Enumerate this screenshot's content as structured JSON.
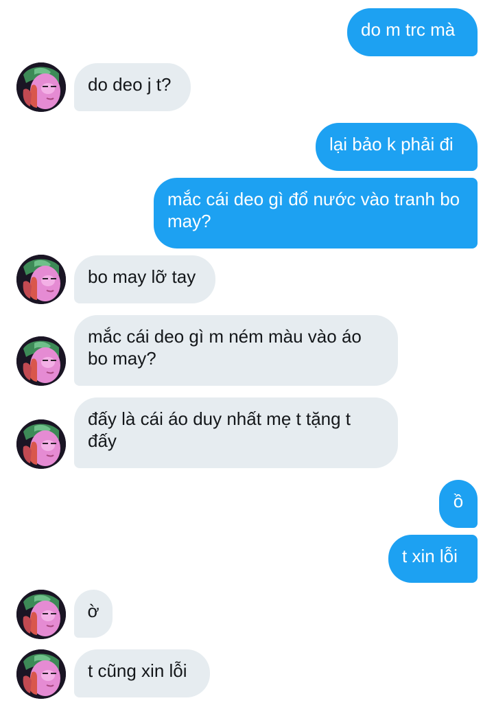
{
  "conversation": {
    "messages": [
      {
        "direction": "sent",
        "text": "do m trc mà"
      },
      {
        "direction": "received",
        "text": "do deo j t?"
      },
      {
        "direction": "sent",
        "text": "lại bảo k phải đi"
      },
      {
        "direction": "sent",
        "text": "mắc cái deo gì đổ nước vào tranh bo may?"
      },
      {
        "direction": "received",
        "text": "bo may lỡ tay"
      },
      {
        "direction": "received",
        "text": "mắc cái deo gì m ném màu vào áo bo may?"
      },
      {
        "direction": "received",
        "text": "đấy là cái áo duy nhất mẹ t tặng t đấy"
      },
      {
        "direction": "sent",
        "text": "ồ"
      },
      {
        "direction": "sent",
        "text": "t xin lỗi"
      },
      {
        "direction": "received",
        "text": "ờ"
      },
      {
        "direction": "received",
        "text": "t cũng xin lỗi"
      }
    ]
  },
  "theme": {
    "sent_bubble_color": "#1da1f2",
    "received_bubble_color": "#e6ecf0",
    "sent_text_color": "#ffffff",
    "received_text_color": "#14171a"
  },
  "icons": {
    "avatar": "user-avatar"
  }
}
